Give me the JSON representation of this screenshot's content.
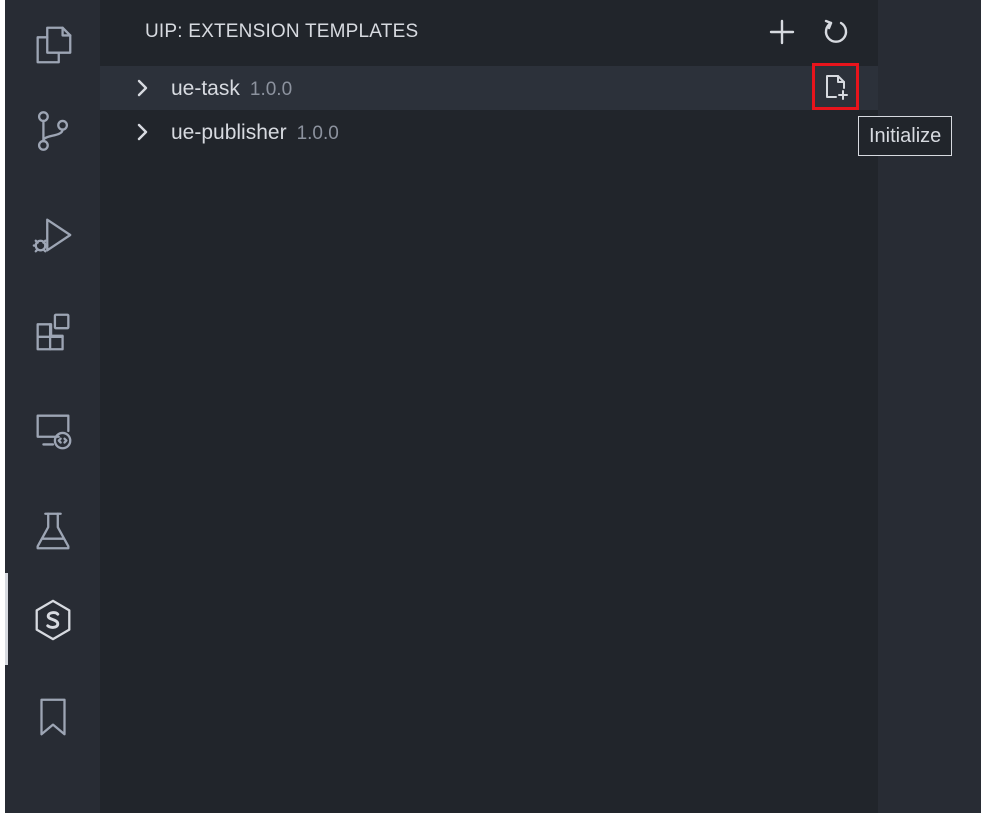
{
  "activity_bar": {
    "items": [
      {
        "id": "explorer",
        "icon": "files-icon"
      },
      {
        "id": "source-control",
        "icon": "source-control-icon"
      },
      {
        "id": "run-debug",
        "icon": "run-debug-icon"
      },
      {
        "id": "extensions",
        "icon": "extensions-icon"
      },
      {
        "id": "remote-explorer",
        "icon": "remote-explorer-icon"
      },
      {
        "id": "testing",
        "icon": "flask-icon"
      },
      {
        "id": "uip",
        "icon": "stonebranch-s-icon",
        "active": true
      },
      {
        "id": "bookmarks",
        "icon": "bookmark-icon"
      }
    ]
  },
  "panel": {
    "title": "UIP: EXTENSION TEMPLATES",
    "actions": [
      {
        "icon": "plus-icon"
      },
      {
        "icon": "refresh-icon"
      }
    ]
  },
  "tree": {
    "items": [
      {
        "name": "ue-task",
        "version": "1.0.0",
        "hovered": true
      },
      {
        "name": "ue-publisher",
        "version": "1.0.0",
        "hovered": false
      }
    ]
  },
  "inline_action": {
    "icon": "new-file-icon",
    "highlighted": true
  },
  "tooltip": {
    "text": "Initialize"
  },
  "colors": {
    "highlight_border": "#e8141c",
    "sidebar_bg": "#21252b",
    "activity_bg": "#282c34",
    "text": "#d7dae0",
    "muted_text": "#8c929e"
  }
}
